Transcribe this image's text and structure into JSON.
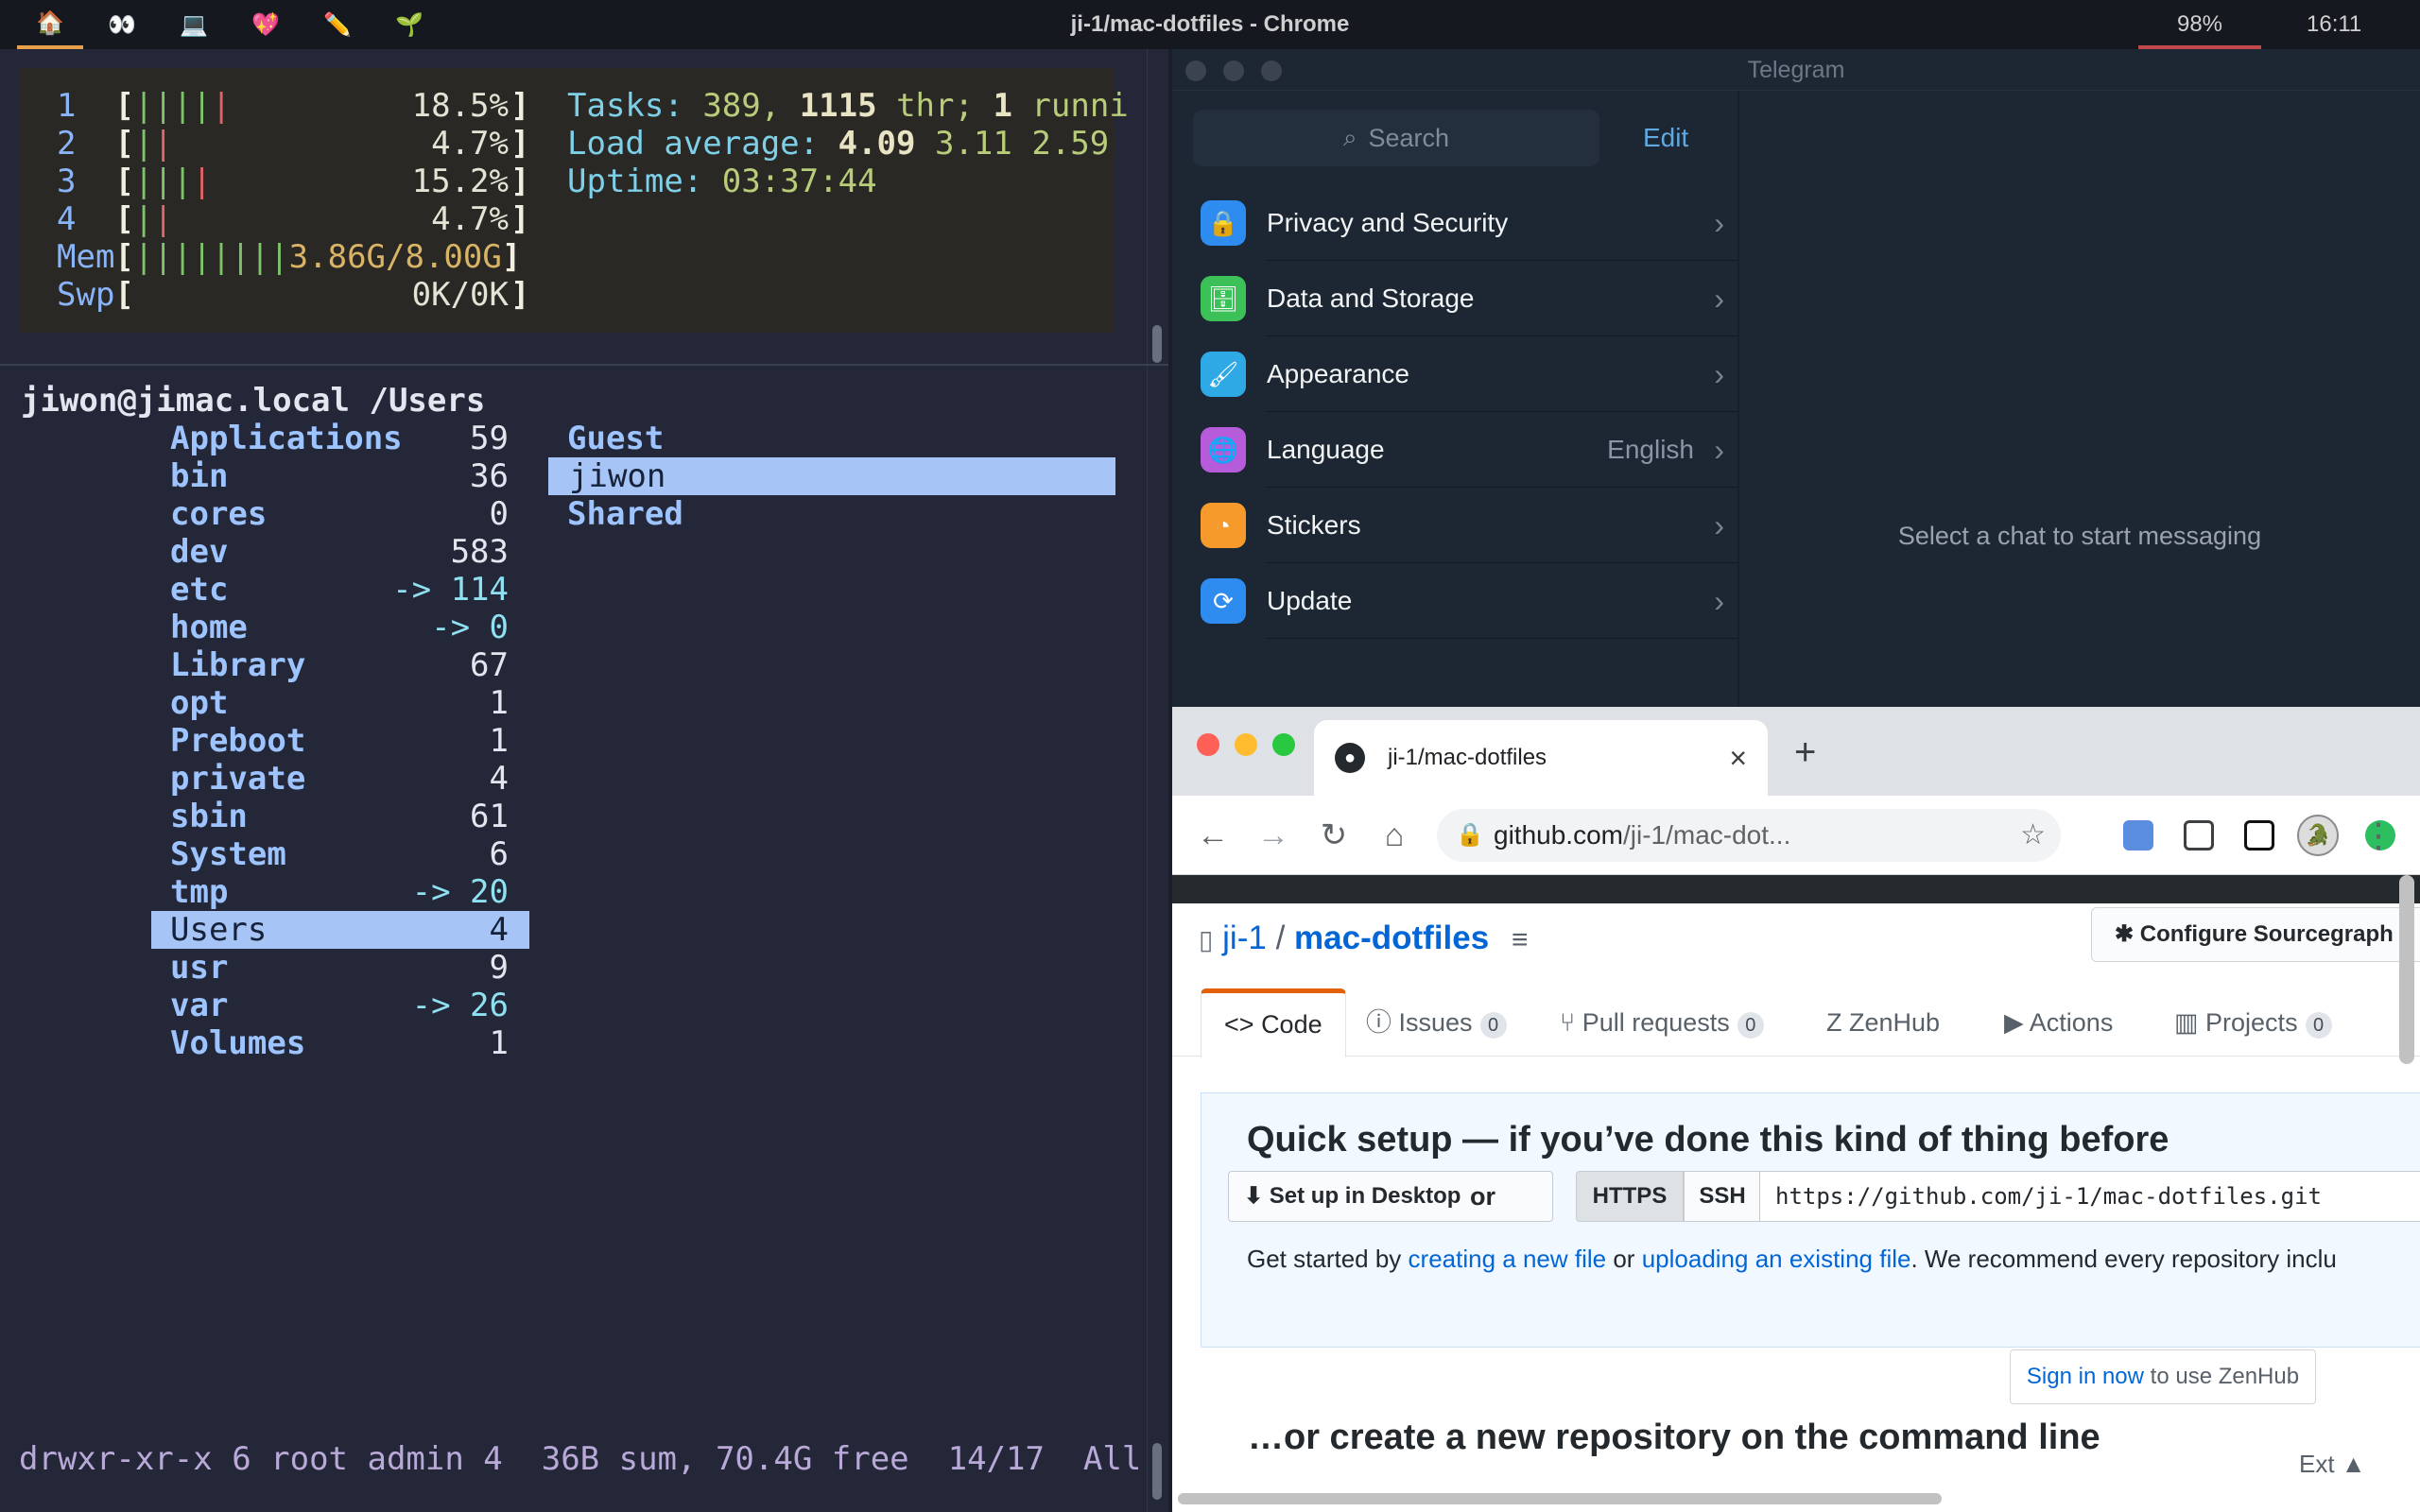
{
  "menubar": {
    "workspaces": [
      "🏠",
      "👀",
      "💻",
      "💖",
      "✏️",
      "🌱"
    ],
    "window_title": "ji-1/mac-dotfiles - Chrome",
    "battery": "98%",
    "clock": "16:11"
  },
  "htop": {
    "cpus": [
      {
        "id": "1",
        "bars_g": "||||",
        "bars_r": "|",
        "pct": "18.5%"
      },
      {
        "id": "2",
        "bars_g": "|",
        "bars_r": "|",
        "pct": "4.7%"
      },
      {
        "id": "3",
        "bars_g": "|||",
        "bars_r": "|",
        "pct": "15.2%"
      },
      {
        "id": "4",
        "bars_g": "|",
        "bars_r": "|",
        "pct": "4.7%"
      }
    ],
    "mem_label": "Mem",
    "mem_bars": "||||||||",
    "mem_value": "3.86G/8.00G",
    "swp_label": "Swp",
    "swp_value": "0K/0K",
    "tasks_label": "Tasks:",
    "tasks_count": "389,",
    "threads": "1115",
    "thr_label": "thr;",
    "running": "1",
    "running_label": "runni",
    "load_label": "Load average:",
    "load1": "4.09",
    "load5": "3.11",
    "load15": "2.59",
    "uptime_label": "Uptime:",
    "uptime": "03:37:44"
  },
  "ranger": {
    "prompt_user": "jiwon@jimac.local",
    "prompt_path": "/Users",
    "entries": [
      {
        "name": "Applications",
        "count": "59"
      },
      {
        "name": "bin",
        "count": "36"
      },
      {
        "name": "cores",
        "count": "0"
      },
      {
        "name": "dev",
        "count": "583"
      },
      {
        "name": "etc",
        "count": "-> 114"
      },
      {
        "name": "home",
        "count": "-> 0"
      },
      {
        "name": "Library",
        "count": "67"
      },
      {
        "name": "opt",
        "count": "1"
      },
      {
        "name": "Preboot",
        "count": "1"
      },
      {
        "name": "private",
        "count": "4"
      },
      {
        "name": "sbin",
        "count": "61"
      },
      {
        "name": "System",
        "count": "6"
      },
      {
        "name": "tmp",
        "count": "-> 20"
      },
      {
        "name": "Users",
        "count": "4"
      },
      {
        "name": "usr",
        "count": "9"
      },
      {
        "name": "var",
        "count": "-> 26"
      },
      {
        "name": "Volumes",
        "count": "1"
      }
    ],
    "preview": [
      "Guest",
      "jiwon",
      "Shared"
    ],
    "status_perms": "drwxr-xr-x",
    "status_info": "6 root admin 4",
    "status_sum": "36B sum, 70.4G free",
    "status_pos": "14/17",
    "status_all": "All"
  },
  "telegram": {
    "title": "Telegram",
    "search_placeholder": "Search",
    "edit": "Edit",
    "settings": [
      {
        "label": "Privacy and Security",
        "value": "",
        "color": "#2e8bf0",
        "icon": "🔒"
      },
      {
        "label": "Data and Storage",
        "value": "",
        "color": "#3cc159",
        "icon": "🗄"
      },
      {
        "label": "Appearance",
        "value": "",
        "color": "#2fa8e6",
        "icon": "🖌"
      },
      {
        "label": "Language",
        "value": "English",
        "color": "#b65bd9",
        "icon": "🌐"
      },
      {
        "label": "Stickers",
        "value": "",
        "color": "#f59a2b",
        "icon": "◔"
      },
      {
        "label": "Update",
        "value": "",
        "color": "#2e8bf0",
        "icon": "⟳"
      }
    ],
    "empty_message": "Select a chat to start messaging"
  },
  "chrome": {
    "tab_title": "ji-1/mac-dotfiles",
    "url_host": "github.com",
    "url_path": "/ji-1/mac-dot...",
    "repo_owner": "ji-1",
    "repo_name": "mac-dotfiles",
    "configure": "Configure Sourcegraph",
    "tabs": [
      {
        "label": "Code",
        "badge": "",
        "icon": "<>"
      },
      {
        "label": "Issues",
        "badge": "0",
        "icon": "ⓘ"
      },
      {
        "label": "Pull requests",
        "badge": "0",
        "icon": "⑂"
      },
      {
        "label": "ZenHub",
        "badge": "",
        "icon": "Z"
      },
      {
        "label": "Actions",
        "badge": "",
        "icon": "▶"
      },
      {
        "label": "Projects",
        "badge": "0",
        "icon": "▥"
      }
    ],
    "quick_setup": "Quick setup — if you’ve done this kind of thing before",
    "desktop_btn": "Set up in Desktop",
    "or": "or",
    "https": "HTTPS",
    "ssh": "SSH",
    "clone_url": "https://github.com/ji-1/mac-dotfiles.git",
    "get_started": "Get started by",
    "link_new": "creating a new file",
    "or_word": "or",
    "link_upload": "uploading an existing file",
    "recommend": ". We recommend every repository inclu",
    "signin": "Sign in now",
    "signin_rest": "to use ZenHub",
    "or_create": "…or create a new repository on the command line",
    "ext": "Ext ▲"
  }
}
